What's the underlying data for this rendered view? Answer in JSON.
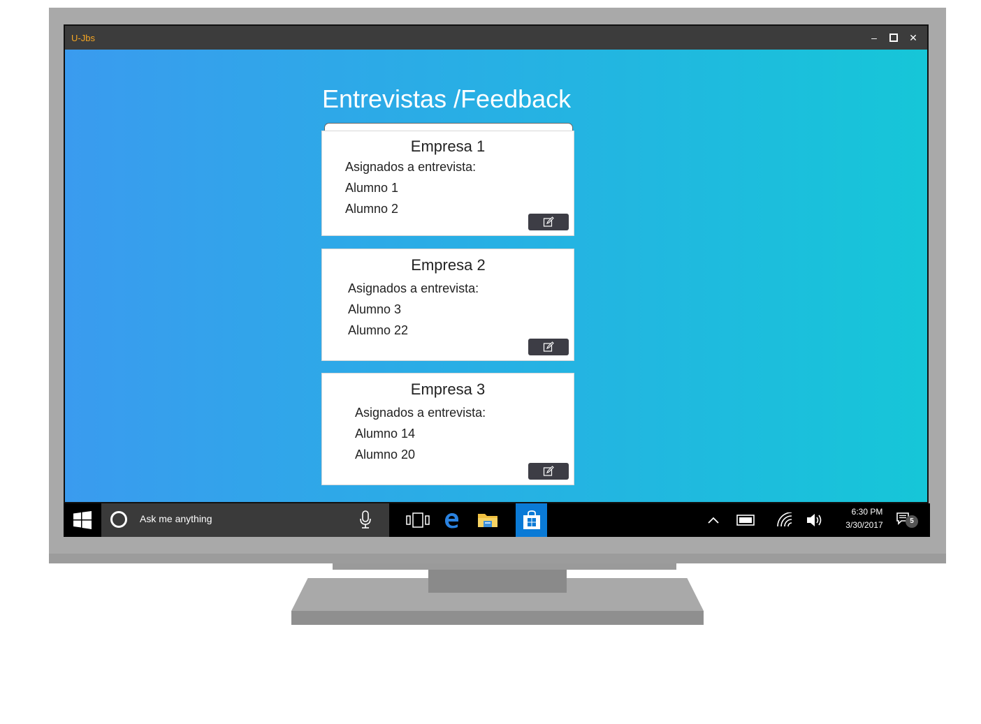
{
  "window": {
    "title": "U-Jbs",
    "minimize_glyph": "–",
    "maximize_glyph": "☐",
    "close_glyph": "✕"
  },
  "page": {
    "title": "Entrevistas /Feedback",
    "search": {
      "placeholder": "",
      "value": ""
    }
  },
  "cards": [
    {
      "company": "Empresa 1",
      "assigned_label": "Asignados a entrevista:",
      "students": [
        "Alumno 1",
        "Alumno 2"
      ],
      "action_icon": "edit-icon"
    },
    {
      "company": "Empresa 2",
      "assigned_label": "Asignados a entrevista:",
      "students": [
        "Alumno 3",
        "Alumno 22"
      ],
      "action_icon": "edit-icon"
    },
    {
      "company": "Empresa 3",
      "assigned_label": "Asignados a entrevista:",
      "students": [
        "Alumno 14",
        "Alumno 20"
      ],
      "action_icon": "edit-icon"
    }
  ],
  "taskbar": {
    "search_text": "Ask me anything",
    "pinned": [
      "task-view-icon",
      "edge-icon",
      "file-explorer-icon",
      "store-icon"
    ],
    "tray": [
      "chevron-up-icon",
      "battery-icon",
      "wifi-icon",
      "volume-icon"
    ],
    "time": "6:30 PM",
    "date": "3/30/2017",
    "notification_count": "5"
  },
  "colors": {
    "gradient_start": "#3a9bef",
    "gradient_end": "#16c6d8",
    "title_accent": "#f5a623",
    "edit_button": "#3d3d45",
    "store_highlight": "#0a7ad6"
  }
}
